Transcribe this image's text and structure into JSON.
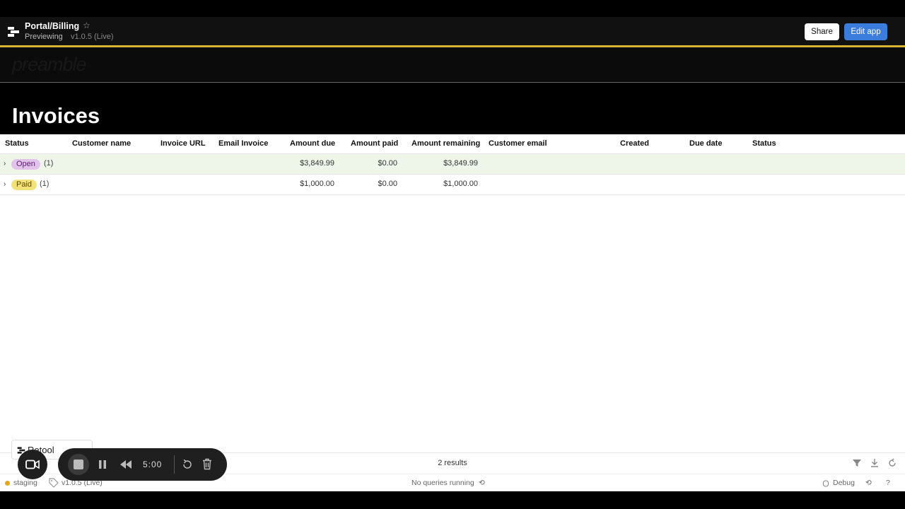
{
  "header": {
    "app_title": "Portal/Billing",
    "mode": "Previewing",
    "version": "v1.0.5 (Live)",
    "share_label": "Share",
    "edit_label": "Edit app"
  },
  "brand": {
    "logo_text": "preamble"
  },
  "page": {
    "title": "Invoices"
  },
  "table": {
    "columns": [
      "Status",
      "Customer name",
      "Invoice URL",
      "Email Invoice",
      "Amount due",
      "Amount paid",
      "Amount remaining",
      "Customer email",
      "Created",
      "Due date",
      "Status"
    ],
    "groups": [
      {
        "status": "Open",
        "count": "(1)",
        "amount_due": "$3,849.99",
        "amount_paid": "$0.00",
        "amount_remaining": "$3,849.99"
      },
      {
        "status": "Paid",
        "count": "(1)",
        "amount_due": "$1,000.00",
        "amount_paid": "$0.00",
        "amount_remaining": "$1,000.00"
      }
    ],
    "results": "2 results"
  },
  "statusbar": {
    "environment": "staging",
    "version": "v1.0.5 (Live)",
    "queries": "No queries running",
    "debug": "Debug"
  },
  "recorder": {
    "timer": "5:00"
  },
  "retool_badge": {
    "label": "Retool"
  },
  "colors": {
    "accent": "#3b7ddd",
    "gold": "#d8b233",
    "open_pill": "#e2c4ea",
    "paid_pill": "#f3e27a"
  }
}
